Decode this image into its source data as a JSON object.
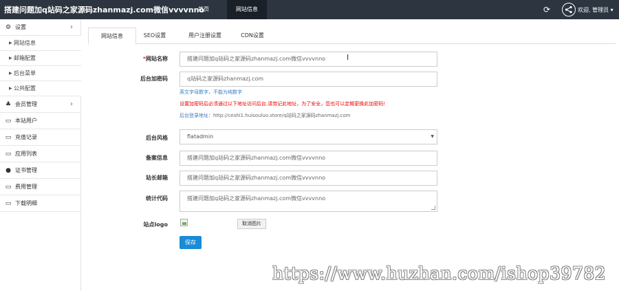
{
  "header": {
    "brand": "搭建问题加q站码之家源码zhanmazj.com微信vvvvnno",
    "nav": [
      {
        "label": "首页"
      },
      {
        "label": "网站信息"
      }
    ],
    "user_welcome": "欢迎, 管理员 ▾"
  },
  "sidebar": {
    "settings": {
      "label": "设置",
      "children": [
        "网站信息",
        "邮箱配置",
        "后台菜单",
        "公共配置"
      ]
    },
    "items": [
      {
        "label": "会员管理"
      },
      {
        "label": "本站用户"
      },
      {
        "label": "充值记录"
      },
      {
        "label": "应用列表"
      },
      {
        "label": "证书管理"
      },
      {
        "label": "费用管理"
      },
      {
        "label": "下载明细"
      }
    ]
  },
  "tabs": [
    "网站信息",
    "SEO设置",
    "用户注册设置",
    "CDN设置"
  ],
  "form": {
    "site_name": {
      "required_mark": "*",
      "label": "网站名称",
      "value": "搭建问题加q站码之家源码zhanmazj.com微信vvvvnno"
    },
    "admin_code": {
      "label": "后台加密码",
      "value": "q站码之家源码zhanmazj.com",
      "help1": "英文字母数字，不能为纯数字",
      "help2": "设置加密码后必须通过以下地址访问后台,请劳记此地址，为了安全，您也可以定期更换此加密码!",
      "help3_label": "后台登录地址：",
      "help3_url": "http://ceshi1.huisouluo.store/q站码之家源码zhanmazj.com"
    },
    "admin_style": {
      "label": "后台风格",
      "value": "flatadmin"
    },
    "icp": {
      "label": "备案信息",
      "value": "搭建问题加q站码之家源码zhanmazj.com微信vvvvnno"
    },
    "email": {
      "label": "站长邮箱",
      "value": "搭建问题加q站码之家源码zhanmazj.com微信vvvvnno"
    },
    "stats_code": {
      "label": "统计代码",
      "value": "搭建问题加q站码之家源码zhanmazj.com微信vvvvnno"
    },
    "logo": {
      "label": "站点logo",
      "cancel_label": "取消图片"
    },
    "save_label": "保存"
  },
  "watermark": "https://www.huzhan.com/ishop39782",
  "colors": {
    "topbar": "#2c3540",
    "primary_button": "#1a8bd6",
    "warning_text": "#ee0000",
    "help_text": "#3a7bbf"
  }
}
